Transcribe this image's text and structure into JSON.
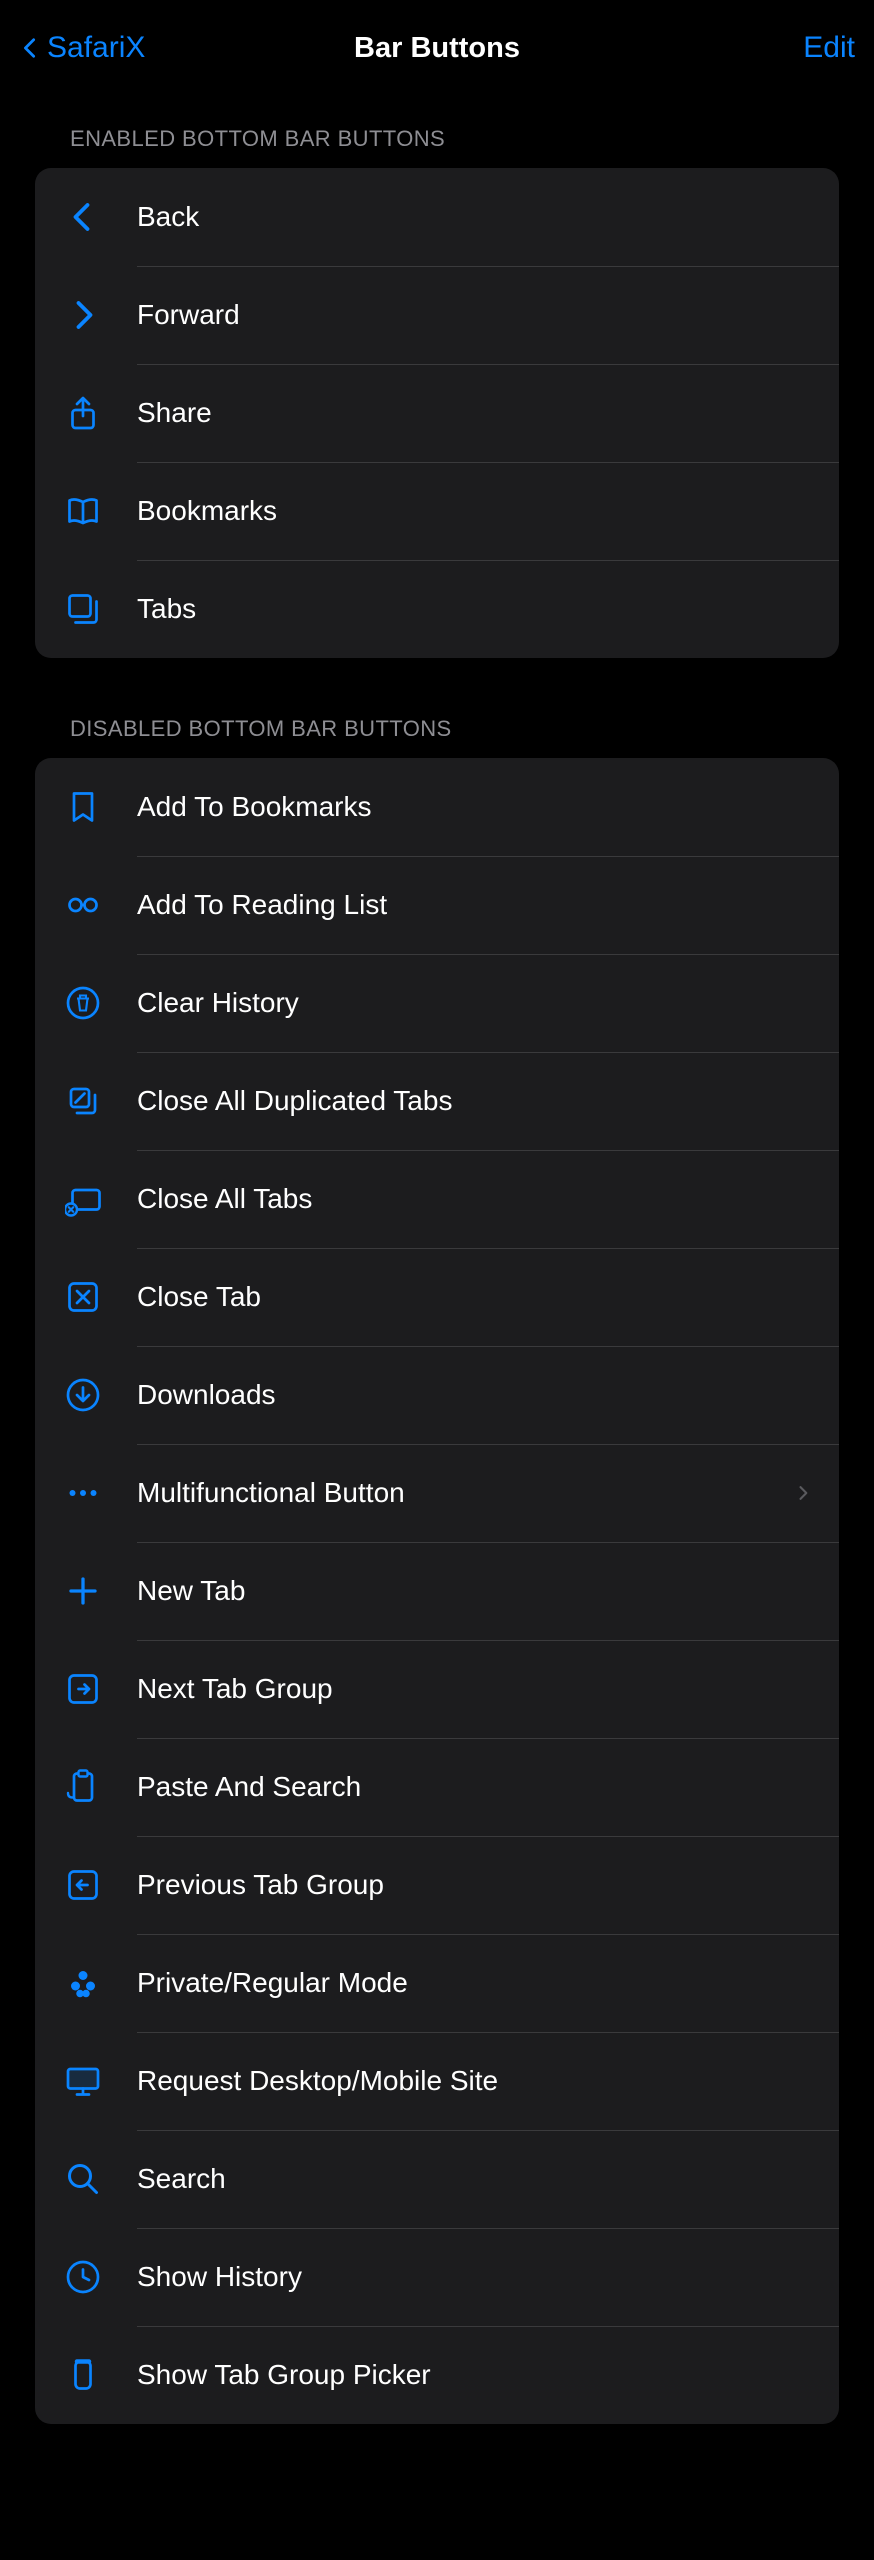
{
  "header": {
    "backLabel": "SafariX",
    "title": "Bar Buttons",
    "editLabel": "Edit"
  },
  "sections": {
    "enabledHeader": "ENABLED BOTTOM BAR BUTTONS",
    "disabledHeader": "DISABLED BOTTOM BAR BUTTONS"
  },
  "enabled": [
    {
      "label": "Back",
      "icon": "chevron-left-icon"
    },
    {
      "label": "Forward",
      "icon": "chevron-right-icon"
    },
    {
      "label": "Share",
      "icon": "share-icon"
    },
    {
      "label": "Bookmarks",
      "icon": "book-icon"
    },
    {
      "label": "Tabs",
      "icon": "tabs-icon"
    }
  ],
  "disabled": [
    {
      "label": "Add To Bookmarks",
      "icon": "bookmark-icon"
    },
    {
      "label": "Add To Reading List",
      "icon": "glasses-icon"
    },
    {
      "label": "Clear History",
      "icon": "trash-circle-icon"
    },
    {
      "label": "Close All Duplicated Tabs",
      "icon": "close-dup-tabs-icon"
    },
    {
      "label": "Close All Tabs",
      "icon": "close-all-tabs-icon"
    },
    {
      "label": "Close Tab",
      "icon": "close-tab-icon"
    },
    {
      "label": "Downloads",
      "icon": "download-circle-icon"
    },
    {
      "label": "Multifunctional Button",
      "icon": "ellipsis-icon",
      "disclosure": true
    },
    {
      "label": "New Tab",
      "icon": "plus-icon"
    },
    {
      "label": "Next Tab Group",
      "icon": "next-group-icon"
    },
    {
      "label": "Paste And Search",
      "icon": "paste-search-icon"
    },
    {
      "label": "Previous Tab Group",
      "icon": "prev-group-icon"
    },
    {
      "label": "Private/Regular Mode",
      "icon": "private-mode-icon"
    },
    {
      "label": "Request Desktop/Mobile Site",
      "icon": "desktop-icon"
    },
    {
      "label": "Search",
      "icon": "search-icon"
    },
    {
      "label": "Show History",
      "icon": "clock-icon"
    },
    {
      "label": "Show Tab Group Picker",
      "icon": "tab-group-picker-icon"
    }
  ],
  "colors": {
    "accent": "#0a84ff",
    "textSecondary": "#8e8e93",
    "cellBg": "#1c1c1e",
    "separator": "#3a3a3c"
  }
}
